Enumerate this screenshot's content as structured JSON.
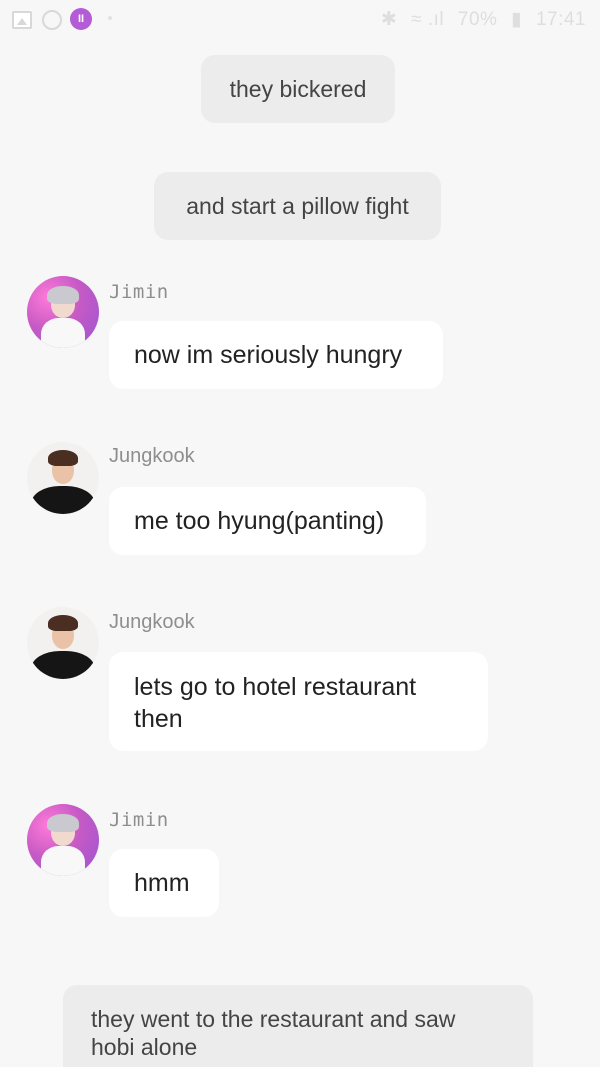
{
  "status_bar": {
    "app_icon_text": "II",
    "right_text": "≈ .ıl 70% ▮ 17:41",
    "battery": "70%",
    "time": "17:41"
  },
  "messages": [
    {
      "type": "narration",
      "text": "they bickered"
    },
    {
      "type": "narration",
      "text": "and start a pillow fight"
    },
    {
      "type": "chat",
      "sender": "Jimin",
      "text": "now im seriously hungry"
    },
    {
      "type": "chat",
      "sender": "Jungkook",
      "text": "me too hyung(panting)"
    },
    {
      "type": "chat",
      "sender": "Jungkook",
      "text": "lets go to hotel restaurant then"
    },
    {
      "type": "chat",
      "sender": "Jimin",
      "text": "hmm"
    },
    {
      "type": "narration",
      "text": "they went to the restaurant and saw hobi alone"
    }
  ]
}
